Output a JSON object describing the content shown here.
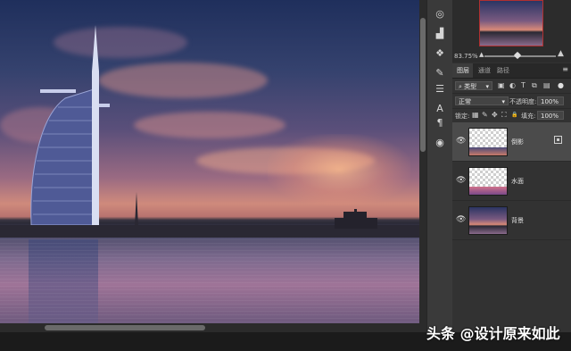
{
  "navigator": {
    "zoom_value": "83.75%",
    "mountain_small_icon": "mountain-small-icon",
    "mountain_large_icon": "mountain-large-icon"
  },
  "tools": [
    {
      "icon": "navigator-icon",
      "glyph": "◎"
    },
    {
      "icon": "histogram-icon",
      "glyph": "▟"
    },
    {
      "icon": "adjustments-icon",
      "glyph": "❖"
    },
    {
      "icon": "brush-settings-icon",
      "glyph": "✎"
    },
    {
      "icon": "properties-icon",
      "glyph": "☰"
    },
    {
      "icon": "character-icon",
      "glyph": "A"
    },
    {
      "icon": "paragraph-icon",
      "glyph": "¶"
    },
    {
      "icon": "libraries-icon",
      "glyph": "◉"
    }
  ],
  "tabs": [
    {
      "label": "图层",
      "active": true
    },
    {
      "label": "通道",
      "active": false
    },
    {
      "label": "路径",
      "active": false
    }
  ],
  "filter": {
    "kind_label": "类型",
    "filter_icons": [
      "▣",
      "◐",
      "T",
      "⧉",
      "▤",
      "●"
    ]
  },
  "blend": {
    "mode": "正常",
    "opacity_label": "不透明度:",
    "opacity_value": "100%"
  },
  "lock": {
    "label": "锁定:",
    "icons": [
      "▦",
      "✎",
      "✥",
      "⛶",
      "🔒"
    ],
    "fill_label": "填充:",
    "fill_value": "100%"
  },
  "layers": [
    {
      "name": "倒影",
      "selected": true,
      "thumb": "reflection"
    },
    {
      "name": "水面",
      "selected": false,
      "thumb": "water"
    },
    {
      "name": "背景",
      "selected": false,
      "thumb": "photo"
    }
  ],
  "watermark": "头条 @设计原来如此",
  "colors": {
    "accent": "#b03030",
    "panel_bg": "#323232",
    "selected_layer": "#4b4b4b"
  }
}
